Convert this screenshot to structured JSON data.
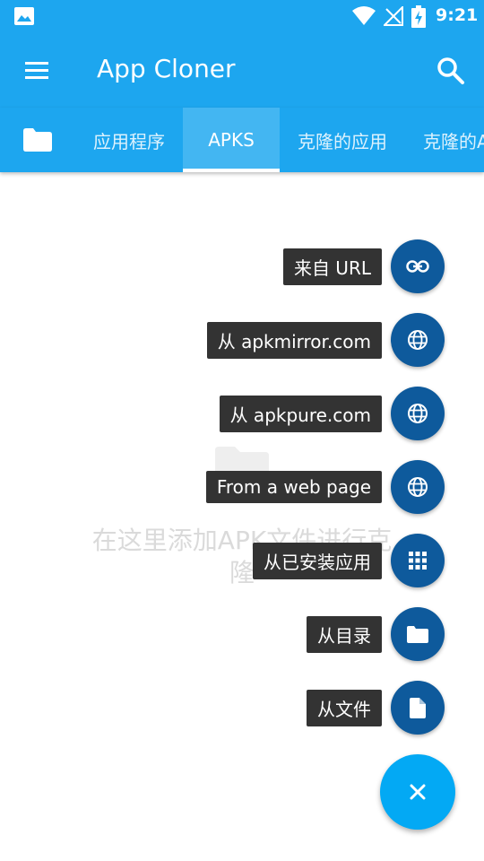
{
  "status_bar": {
    "time": "9:21"
  },
  "app_bar": {
    "title": "App Cloner"
  },
  "tabs": [
    {
      "label": "应用程序"
    },
    {
      "label": "APKS"
    },
    {
      "label": "克隆的应用"
    },
    {
      "label": "克隆的APK"
    }
  ],
  "empty_state": {
    "text": "在这里添加APK文件进行克隆"
  },
  "fab_menu": [
    {
      "label": "来自 URL",
      "icon": "link-icon"
    },
    {
      "label": "从 apkmirror.com",
      "icon": "globe-icon"
    },
    {
      "label": "从 apkpure.com",
      "icon": "globe-icon"
    },
    {
      "label": "From a web page",
      "icon": "globe-icon"
    },
    {
      "label": "从已安装应用",
      "icon": "grid-icon"
    },
    {
      "label": "从目录",
      "icon": "folder-icon"
    },
    {
      "label": "从文件",
      "icon": "file-icon"
    }
  ],
  "colors": {
    "primary": "#1da6ef",
    "accent": "#03a9f4",
    "mini_fab": "#0e5a9c",
    "label_bg": "#333333"
  }
}
